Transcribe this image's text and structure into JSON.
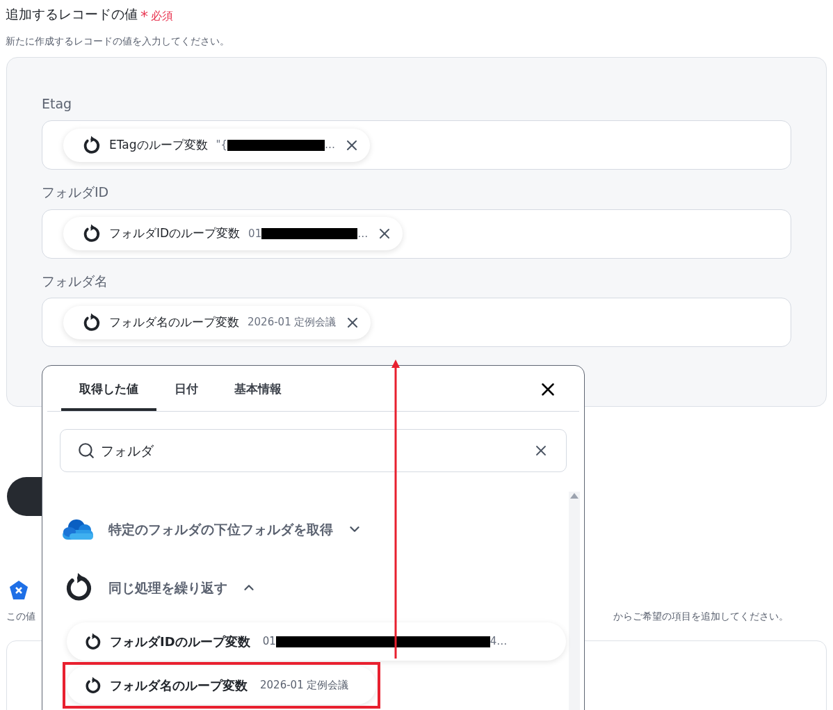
{
  "header": {
    "title": "追加するレコードの値",
    "required_mark": "*",
    "required_label": "必須",
    "description": "新たに作成するレコードの値を入力してください。"
  },
  "fields": [
    {
      "label": "Etag",
      "chip": {
        "name": "ETagのループ変数",
        "value_start": "\"{",
        "redacted": true,
        "value_end": "…"
      }
    },
    {
      "label": "フォルダID",
      "chip": {
        "name": "フォルダIDのループ変数",
        "value_start": "01",
        "redacted": true,
        "value_end": "…"
      }
    },
    {
      "label": "フォルダ名",
      "chip": {
        "name": "フォルダ名のループ変数",
        "value_start": "2026-01 定例会議",
        "redacted": false
      }
    }
  ],
  "behind": {
    "note_start": "この値",
    "note_end": "からご希望の項目を追加してください。"
  },
  "picker": {
    "tabs": [
      {
        "label": "取得した値",
        "selected": true
      },
      {
        "label": "日付",
        "selected": false
      },
      {
        "label": "基本情報",
        "selected": false
      }
    ],
    "search": {
      "value": "フォルダ"
    },
    "groups": [
      {
        "title": "特定のフォルダの下位フォルダを取得",
        "kind": "cloud",
        "expanded": false
      },
      {
        "title": "同じ処理を繰り返す",
        "kind": "loop",
        "expanded": true,
        "items": [
          {
            "name": "フォルダIDのループ変数",
            "value_start": "01",
            "redacted": true,
            "value_end": "4…",
            "highlighted": false
          },
          {
            "name": "フォルダ名のループ変数",
            "value_start": "2026-01 定例会議",
            "redacted": false,
            "highlighted": true
          }
        ]
      }
    ]
  }
}
